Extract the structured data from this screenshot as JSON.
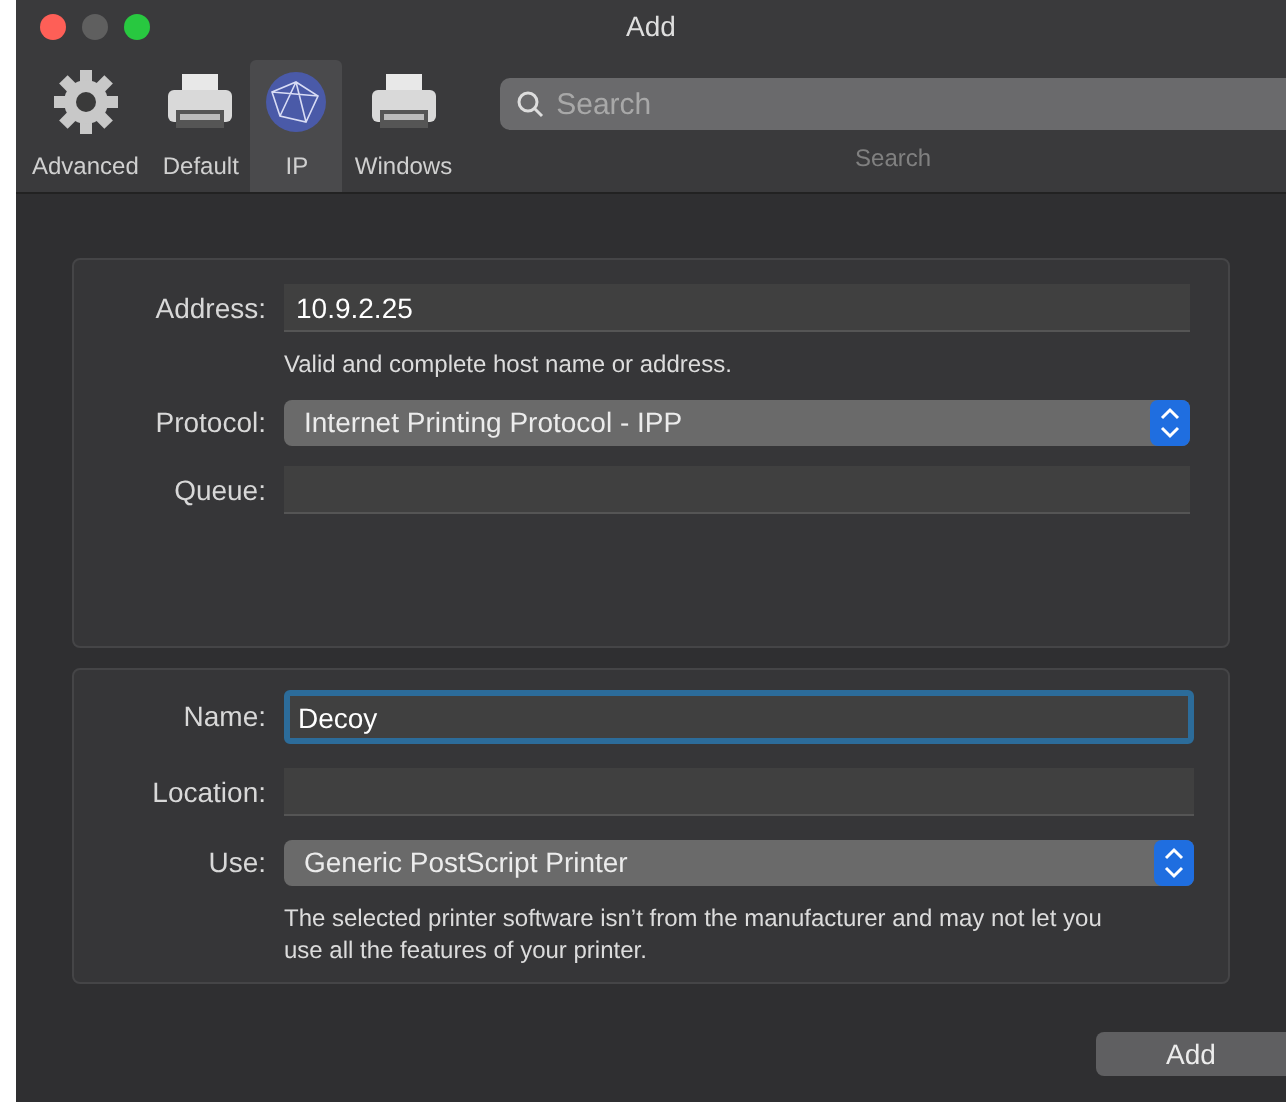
{
  "window": {
    "title": "Add",
    "traffic_lights": [
      {
        "color": "#fe5f57"
      },
      {
        "color": "#5f5f5f"
      },
      {
        "color": "#28c840"
      }
    ]
  },
  "toolbar": {
    "items": [
      {
        "label": "Advanced",
        "kind": "gear",
        "selected": false
      },
      {
        "label": "Default",
        "kind": "printer",
        "selected": false
      },
      {
        "label": "IP",
        "kind": "globe",
        "selected": true
      },
      {
        "label": "Windows",
        "kind": "printer",
        "selected": false
      }
    ],
    "search": {
      "placeholder": "Search",
      "label": "Search"
    }
  },
  "connection": {
    "rows": [
      {
        "kind": "field",
        "label": "Address:",
        "value": "10.9.2.25",
        "hint": "Valid and complete host name or address."
      },
      {
        "kind": "popup",
        "label": "Protocol:",
        "value": "Internet Printing Protocol - IPP"
      },
      {
        "kind": "field",
        "label": "Queue:",
        "value": ""
      }
    ]
  },
  "printer": {
    "rows": [
      {
        "kind": "field",
        "label": "Name:",
        "value": "Decoy",
        "focused": true
      },
      {
        "kind": "field",
        "label": "Location:",
        "value": "",
        "focused": false
      },
      {
        "kind": "popup",
        "label": "Use:",
        "value": "Generic PostScript Printer",
        "hint": "The selected printer software isn’t from the manufacturer and may not let you use all the features of your printer."
      }
    ]
  },
  "buttons": [
    {
      "label": "Add"
    }
  ]
}
